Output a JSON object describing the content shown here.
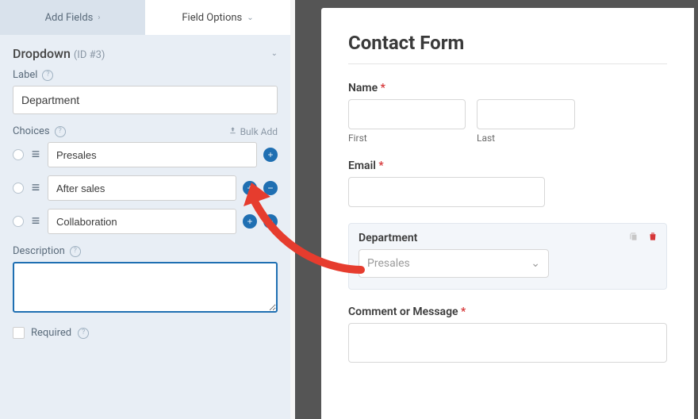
{
  "tabs": {
    "add_fields": "Add Fields",
    "field_options": "Field Options"
  },
  "section": {
    "title": "Dropdown",
    "id": "(ID #3)"
  },
  "labels": {
    "label": "Label",
    "choices": "Choices",
    "bulk_add": "Bulk Add",
    "description": "Description",
    "required": "Required"
  },
  "values": {
    "label_input": "Department",
    "description_input": ""
  },
  "choices": [
    {
      "value": "Presales",
      "has_remove": false
    },
    {
      "value": "After sales",
      "has_remove": true
    },
    {
      "value": "Collaboration",
      "has_remove": true
    }
  ],
  "preview": {
    "title": "Contact Form",
    "name_label": "Name",
    "first": "First",
    "last": "Last",
    "email_label": "Email",
    "department_label": "Department",
    "department_selected": "Presales",
    "comment_label": "Comment or Message"
  }
}
